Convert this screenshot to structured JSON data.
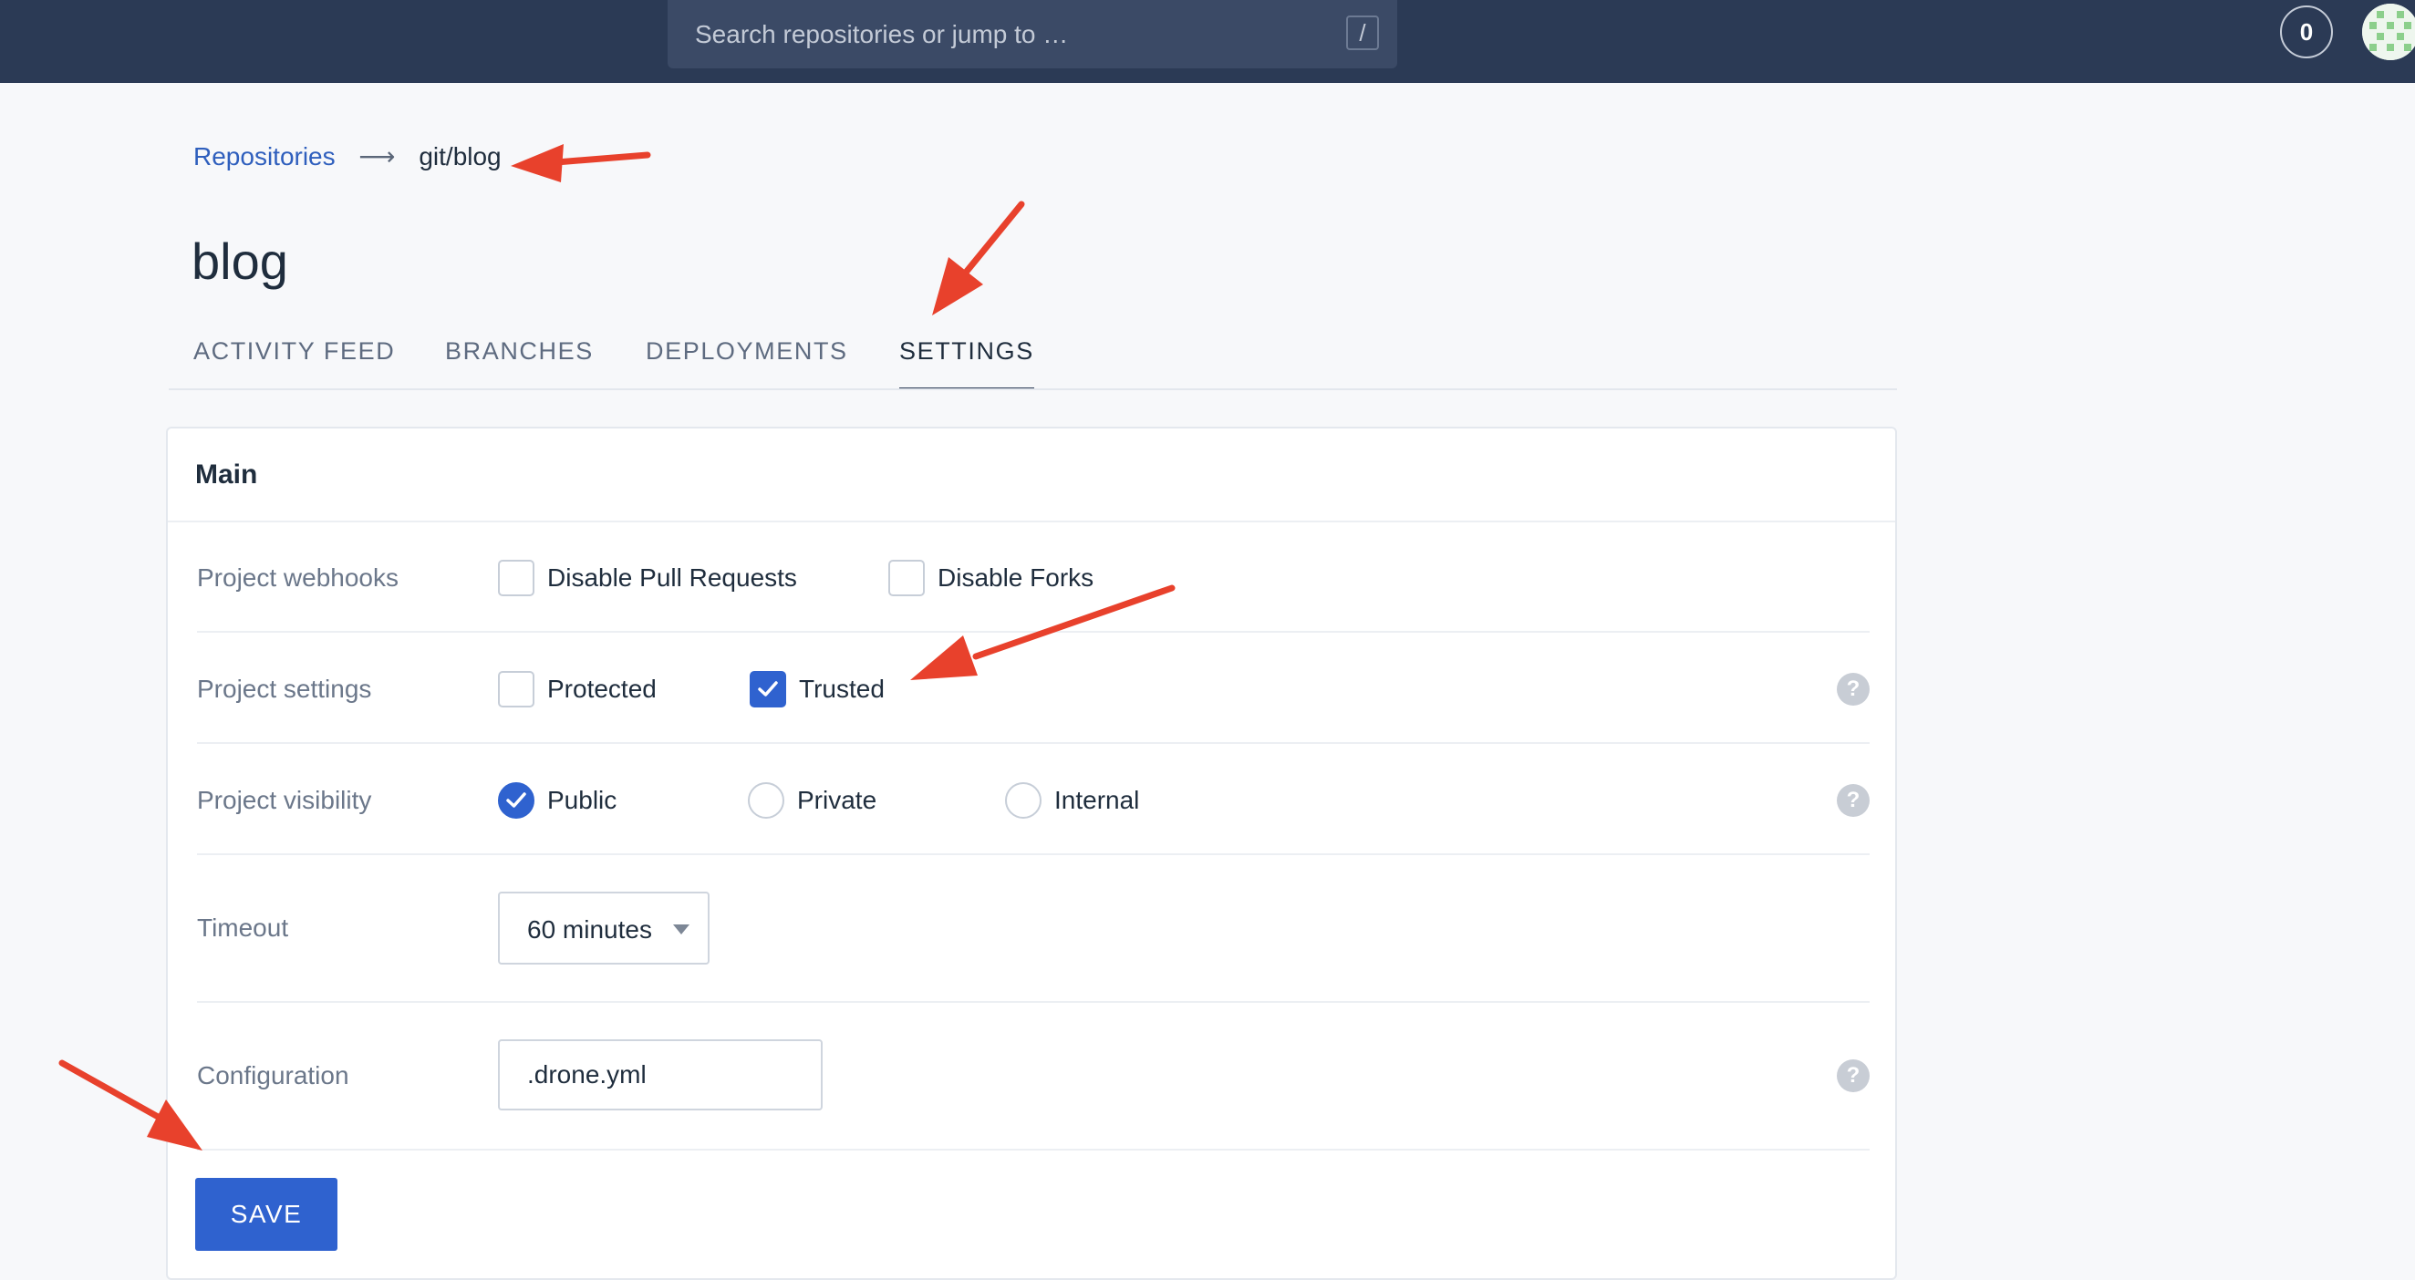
{
  "topbar": {
    "search_placeholder": "Search repositories or jump to …",
    "search_shortcut": "/",
    "counter": "0"
  },
  "breadcrumb": {
    "root": "Repositories",
    "arrow": "⟶",
    "current": "git/blog"
  },
  "page": {
    "title": "blog"
  },
  "tabs": [
    {
      "label": "ACTIVITY FEED",
      "active": false
    },
    {
      "label": "BRANCHES",
      "active": false
    },
    {
      "label": "DEPLOYMENTS",
      "active": false
    },
    {
      "label": "SETTINGS",
      "active": true
    }
  ],
  "card": {
    "title": "Main",
    "webhooks": {
      "label": "Project webhooks",
      "options": [
        {
          "label": "Disable Pull Requests",
          "checked": false
        },
        {
          "label": "Disable Forks",
          "checked": false
        }
      ]
    },
    "settings": {
      "label": "Project settings",
      "options": [
        {
          "label": "Protected",
          "checked": false
        },
        {
          "label": "Trusted",
          "checked": true
        }
      ]
    },
    "visibility": {
      "label": "Project visibility",
      "options": [
        {
          "label": "Public",
          "selected": true
        },
        {
          "label": "Private",
          "selected": false
        },
        {
          "label": "Internal",
          "selected": false
        }
      ]
    },
    "timeout": {
      "label": "Timeout",
      "value": "60 minutes"
    },
    "configuration": {
      "label": "Configuration",
      "value": ".drone.yml"
    },
    "help_glyph": "?",
    "save_label": "SAVE"
  },
  "colors": {
    "topbar": "#2b3a55",
    "accent": "#2f62cf",
    "link": "#2f5fbd",
    "annotation_arrow": "#e8412c"
  },
  "icons": [
    "slash-key-icon",
    "avatar-identicon",
    "check-icon",
    "help-icon",
    "chevron-down-icon"
  ],
  "annotations": [
    "breadcrumb-arrow",
    "settings-tab-arrow",
    "trusted-checkbox-arrow",
    "save-button-arrow"
  ]
}
